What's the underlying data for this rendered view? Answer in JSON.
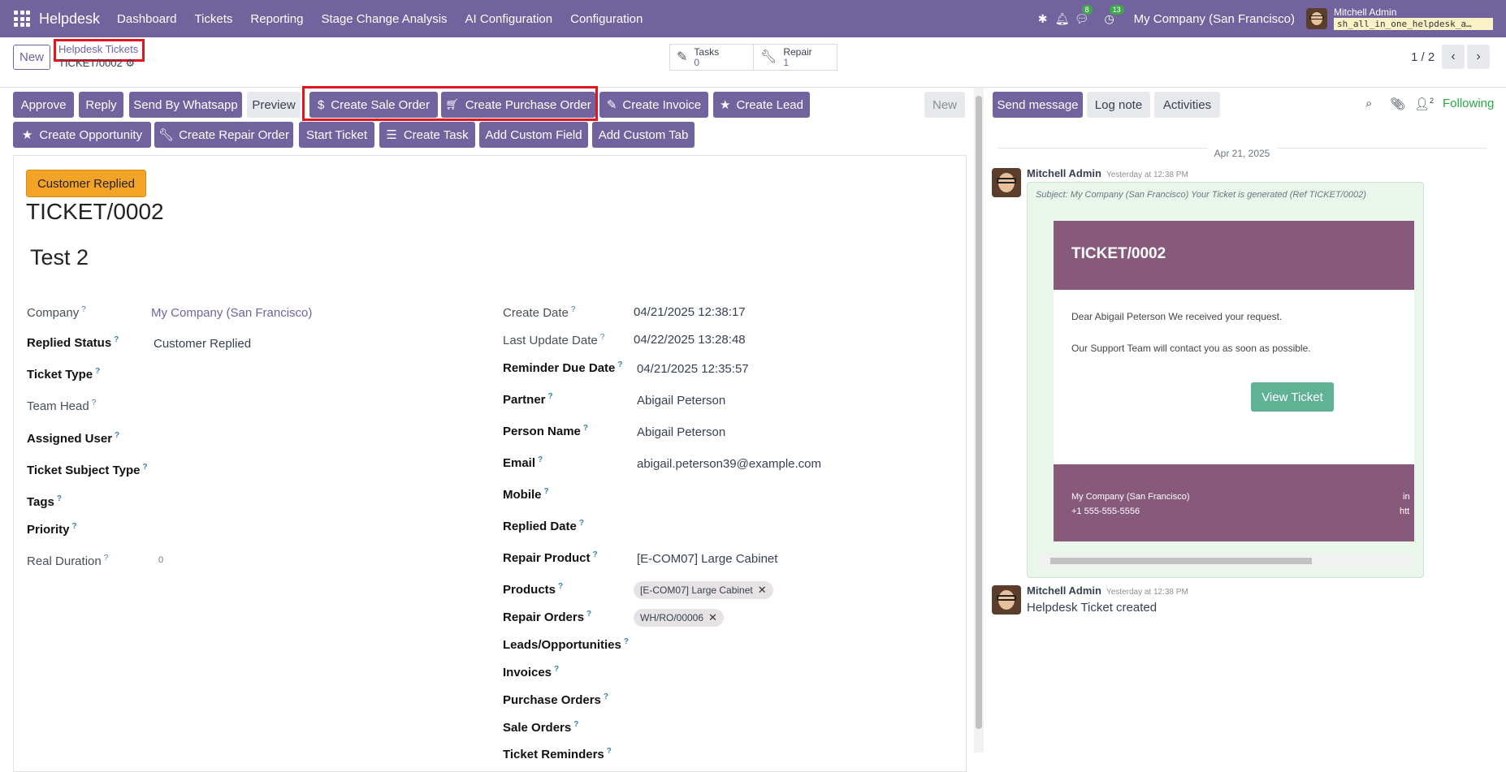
{
  "topbar": {
    "app": "Helpdesk",
    "menu": [
      "Dashboard",
      "Tickets",
      "Reporting",
      "Stage Change Analysis",
      "AI Configuration",
      "Configuration"
    ],
    "chat_count": "8",
    "activity_count": "13",
    "company": "My Company (San Francisco)",
    "user_name": "Mitchell Admin",
    "database": "sh_all_in_one_helpdesk_a…"
  },
  "control": {
    "new_label": "New",
    "breadcrumb": "Helpdesk Tickets",
    "record": "TICKET/0002",
    "tasks_label": "Tasks",
    "tasks_count": "0",
    "repair_label": "Repair",
    "repair_count": "1",
    "pager": "1 / 2"
  },
  "actions": {
    "row1": [
      "Approve",
      "Reply",
      "Send By Whatsapp",
      "Preview",
      "Create Sale Order",
      "Create Purchase Order",
      "Create Invoice",
      "Create Lead"
    ],
    "new_label": "New",
    "row2": [
      "Create Opportunity",
      "Create Repair Order",
      "Start Ticket",
      "Create Task",
      "Add Custom Field",
      "Add Custom Tab"
    ]
  },
  "form": {
    "stage": "Customer Replied",
    "ticket_no": "TICKET/0002",
    "name": "Test 2",
    "left": [
      {
        "label": "Company",
        "value": "My Company (San Francisco)"
      },
      {
        "label": "Replied Status",
        "value": "Customer Replied"
      },
      {
        "label": "Ticket Type",
        "value": ""
      },
      {
        "label": "Team Head",
        "value": ""
      },
      {
        "label": "Assigned User",
        "value": ""
      },
      {
        "label": "Ticket Subject Type",
        "value": ""
      },
      {
        "label": "Tags",
        "value": ""
      },
      {
        "label": "Priority",
        "value": ""
      },
      {
        "label": "Real Duration",
        "value": "0"
      }
    ],
    "right": [
      {
        "label": "Create Date",
        "value": "04/21/2025 12:38:17"
      },
      {
        "label": "Last Update Date",
        "value": "04/22/2025 13:28:48"
      },
      {
        "label": "Reminder Due Date",
        "value": "04/21/2025 12:35:57"
      },
      {
        "label": "Partner",
        "value": "Abigail Peterson"
      },
      {
        "label": "Person Name",
        "value": "Abigail Peterson"
      },
      {
        "label": "Email",
        "value": "abigail.peterson39@example.com"
      },
      {
        "label": "Mobile",
        "value": ""
      },
      {
        "label": "Replied Date",
        "value": ""
      },
      {
        "label": "Repair Product",
        "value": "[E-COM07] Large Cabinet"
      },
      {
        "label": "Products",
        "value": "[E-COM07] Large Cabinet"
      },
      {
        "label": "Repair Orders",
        "value": "WH/RO/00006"
      },
      {
        "label": "Leads/Opportunities",
        "value": ""
      },
      {
        "label": "Invoices",
        "value": ""
      },
      {
        "label": "Purchase Orders",
        "value": ""
      },
      {
        "label": "Sale Orders",
        "value": ""
      },
      {
        "label": "Ticket Reminders",
        "value": ""
      }
    ]
  },
  "chatter": {
    "send": "Send message",
    "log": "Log note",
    "activities": "Activities",
    "followers": "2",
    "following": "Following",
    "date": "Apr 21, 2025",
    "msg1": {
      "author": "Mitchell Admin",
      "time": "Yesterday at 12:38 PM",
      "subject": "Subject: My Company (San Francisco) Your Ticket is generated (Ref TICKET/0002)",
      "title": "TICKET/0002",
      "line1": "Dear Abigail Peterson We received your request.",
      "line2": "Our Support Team will contact you as soon as possible.",
      "button": "View Ticket",
      "footer_company": "My Company (San Francisco)",
      "footer_phone": "+1 555-555-5556",
      "footer_r1": "in",
      "footer_r2": "htt"
    },
    "msg2": {
      "author": "Mitchell Admin",
      "time": "Yesterday at 12:38 PM",
      "body": "Helpdesk Ticket created"
    }
  }
}
